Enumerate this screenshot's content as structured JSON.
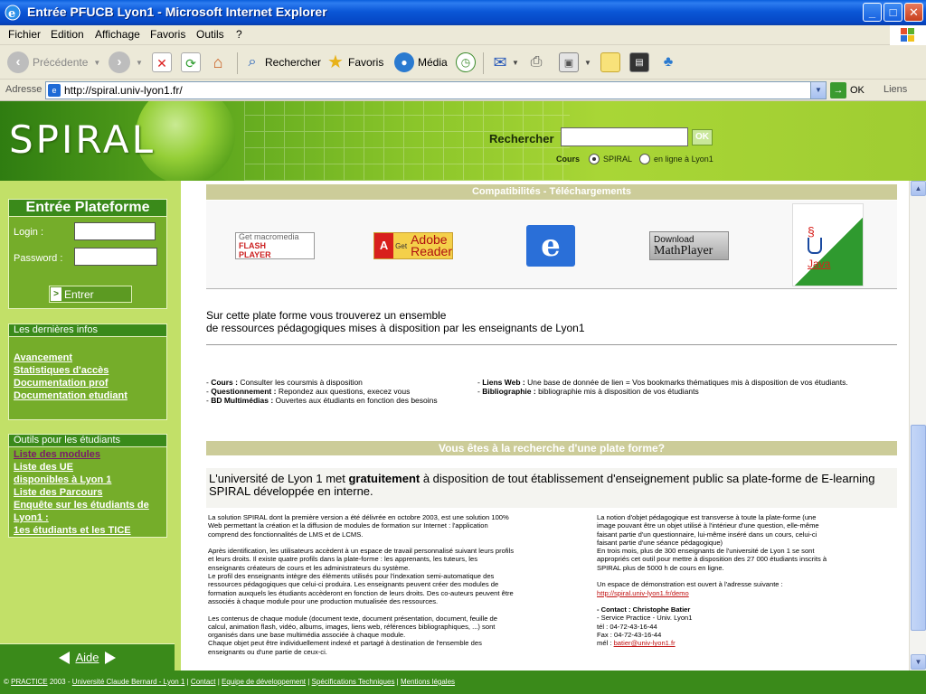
{
  "window": {
    "title": "Entrée PFUCB Lyon1 - Microsoft Internet Explorer",
    "minimize": "_",
    "maximize": "□",
    "close": "✕"
  },
  "menu": [
    "Fichier",
    "Edition",
    "Affichage",
    "Favoris",
    "Outils",
    "?"
  ],
  "toolbar": {
    "back": "Précédente",
    "search": "Rechercher",
    "favorites": "Favoris",
    "media": "Média"
  },
  "address": {
    "label": "Adresse",
    "url": "http://spiral.univ-lyon1.fr/",
    "go": "OK",
    "links": "Liens"
  },
  "banner": {
    "logo": "SPIRAL",
    "search_label": "Rechercher",
    "ok": "OK",
    "scope_label": "Cours",
    "option_spiral": "SPIRAL",
    "option_lyon": "en ligne à Lyon1",
    "selected": "SPIRAL"
  },
  "login": {
    "title": "Entrée Plateforme",
    "login_label": "Login :",
    "password_label": "Password :",
    "enter": "Entrer",
    "enter_glyph": ">"
  },
  "news": {
    "title": "Les dernières infos",
    "items": [
      "Avancement",
      "Statistiques d'accès",
      "Documentation prof",
      "Documentation etudiant"
    ]
  },
  "tools": {
    "title": "Outils pour les étudiants",
    "items": [
      "Liste des modules",
      "Liste des UE",
      "disponibles à Lyon 1",
      "Liste des Parcours",
      "Enquête sur les étudiants de",
      "Lyon1 :",
      "1es étudiants et les TICE"
    ]
  },
  "help": "Aide",
  "compat": {
    "title": "Compatibilités - Téléchargements",
    "flash": [
      "Get macromedia",
      "FLASH",
      "PLAYER"
    ],
    "adobe": [
      "Get",
      "Adobe",
      "Reader"
    ],
    "adobe_letter": "A",
    "ie_letter": "e",
    "mathplayer": [
      "Download",
      "MathPlayer"
    ],
    "java": "Java"
  },
  "intro": {
    "line1": "Sur cette plate forme vous trouverez un ensemble",
    "line2": "de ressources pédagogiques mises à disposition par les enseignants de Lyon1"
  },
  "features": {
    "left": [
      {
        "name": "Cours",
        "desc": "Consulter les coursmis à disposition"
      },
      {
        "name": "Questionnement",
        "desc": "Repondez aux questions, execez vous"
      },
      {
        "name": "BD Multimédias",
        "desc": "Ouvertes aux étudiants en fonction des besoins"
      }
    ],
    "right": [
      {
        "name": "Liens Web",
        "desc": "Une base de donnée de lien = Vos bookmarks thématiques mis à disposition de vos étudiants."
      },
      {
        "name": "Bibliographie",
        "desc": "bibliographie mis à disposition de vos étudiants"
      }
    ]
  },
  "search_section": {
    "title": "Vous êtes à la recherche d'une plate forme?",
    "text_before": "L'université de Lyon 1 met ",
    "text_bold": "gratuitement",
    "text_after": " à disposition de tout établissement d'enseignement public sa plate-forme de E-learning",
    "text_line2": "SPIRAL développée en interne."
  },
  "left_text": [
    "La solution SPIRAL dont la première version a été délivrée en octobre 2003, est une solution 100%",
    "Web permettant la création et la diffusion de modules de formation sur Internet : l'application",
    "comprend des fonctionnalités de LMS et de LCMS.",
    "",
    "Après identification, les utilisateurs accèdent à un espace de travail personnalisé suivant leurs profils",
    "et leurs droits. Il existe quatre profils dans la plate-forme : les apprenants, les tuteurs, les",
    "enseignants créateurs de cours et les administrateurs du système.",
    "Le profil des enseignants intègre des éléments utilisés pour l'indexation semi-automatique des",
    "ressources pédagogiques que celui-ci produira. Les enseignants peuvent créer des modules de",
    "formation auxquels les étudiants accèderont en fonction de leurs droits. Des co-auteurs peuvent être",
    "associés à chaque module pour une production mutualisée des ressources.",
    "",
    "Les contenus de chaque module (document texte, document présentation, document, feuille de",
    "calcul, animation flash, vidéo, albums, images, liens web, références bibliographiques, ...) sont",
    "organisés dans une base multimédia associée à chaque module.",
    "Chaque objet peut être individuellement indexé et partagé à destination de l'ensemble des",
    "enseignants ou d'une partie de ceux-ci."
  ],
  "right_text": [
    "La notion d'objet pédagogique est transverse à toute la plate-forme (une",
    "image pouvant être un objet utilisé à l'intérieur d'une question, elle-même",
    "faisant partie d'un questionnaire, lui-même inséré dans un cours, celui-ci",
    "faisant partie d'une séance pédagogique)",
    "En trois mois, plus de 300 enseignants de l'université de Lyon 1 se sont",
    "appropriés cet outil pour mettre à disposition des 27 000 étudiants inscrits à",
    "SPIRAL plus de 5000 h de cours en ligne.",
    "",
    "Un espace de démonstration est ouvert à l'adresse suivante :"
  ],
  "demo_url": "http://spiral.univ-lyon1.fr/demo",
  "contact": {
    "title": "- Contact : Christophe Batier",
    "service": "- Service Practice - Univ. Lyon1",
    "tel": "tél : 04-72-43-16-44",
    "fax": "Fax : 04-72-43-16-44",
    "mel_label": "mél : ",
    "email": "batier@univ-lyon1.fr"
  },
  "footer": {
    "copy": "©",
    "practice": "PRACTICE",
    "year": " 2003 - ",
    "links": [
      "Université Claude Bernard - Lyon 1",
      "Contact",
      "Equipe de développement",
      "Spécifications Techniques",
      "Mentions légales"
    ]
  }
}
